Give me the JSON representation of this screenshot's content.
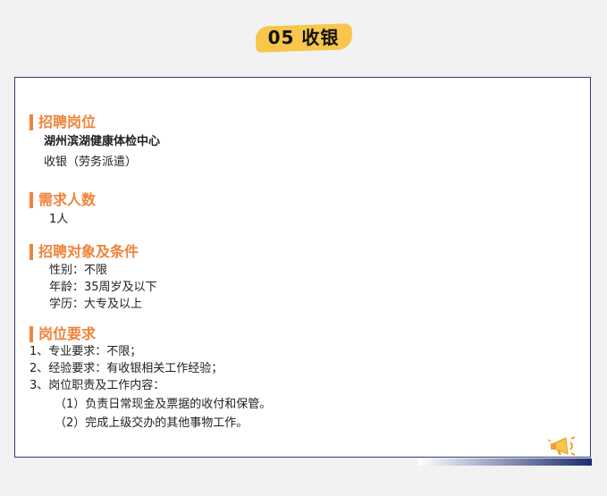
{
  "header": {
    "title": "05 收银"
  },
  "sections": {
    "position": {
      "heading": "招聘岗位",
      "company": "湖州滨湖健康体检中心",
      "role": "收银（劳务派遣）"
    },
    "headcount": {
      "heading": "需求人数",
      "value": "1人"
    },
    "conditions": {
      "heading": "招聘对象及条件",
      "items": [
        "性别：不限",
        "年龄：35周岁及以下",
        "学历：大专及以上"
      ]
    },
    "requirements": {
      "heading": "岗位要求",
      "items": [
        "1、专业要求：不限；",
        "2、经验要求：有收银相关工作经验；",
        "3、岗位职责及工作内容："
      ],
      "duties": [
        "（1）负责日常现金及票据的收付和保管。",
        "（2）完成上级交办的其他事物工作。"
      ]
    }
  },
  "colors": {
    "accent": "#f0833a",
    "highlight": "#f7c64a",
    "border": "#2c3e7a"
  },
  "icons": {
    "decoration": "megaphone-icon"
  }
}
